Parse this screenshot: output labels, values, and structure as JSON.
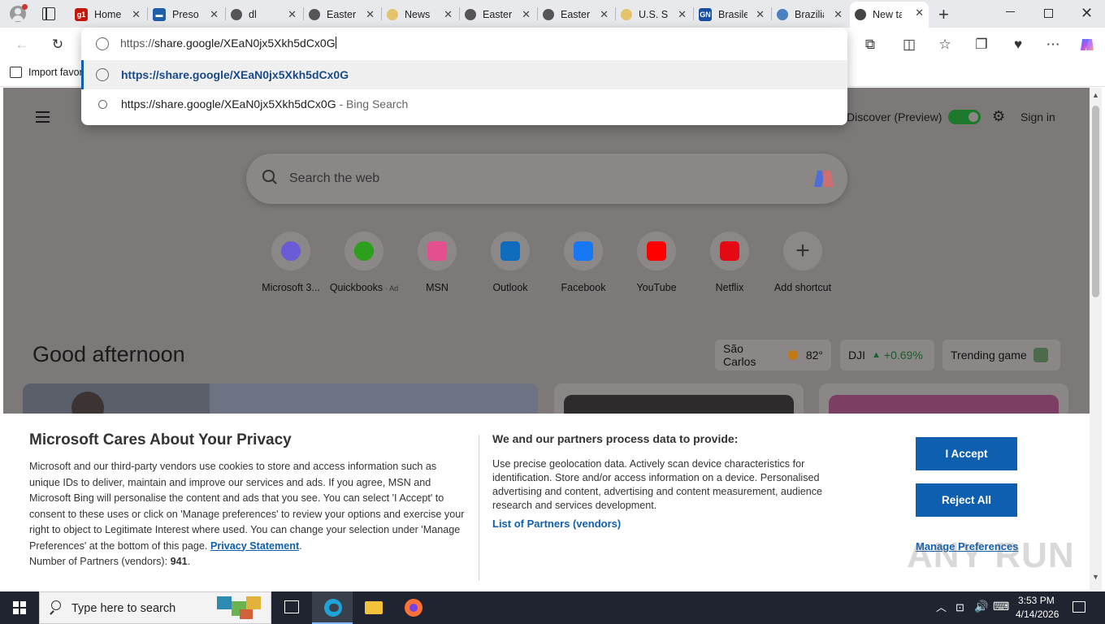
{
  "tabs": [
    {
      "title": "Home",
      "favicon_text": "g1",
      "favicon_color": "#c4170c"
    },
    {
      "title": "Preso",
      "favicon_text": "▬",
      "favicon_color": "#1f5fa8"
    },
    {
      "title": "dl",
      "favicon_text": "",
      "favicon_color": "#555555"
    },
    {
      "title": "Eastern",
      "favicon_text": "",
      "favicon_color": "#555555"
    },
    {
      "title": "News",
      "favicon_text": "",
      "favicon_color": "#e3c46b"
    },
    {
      "title": "Eastern",
      "favicon_text": "",
      "favicon_color": "#555555"
    },
    {
      "title": "Eastern",
      "favicon_text": "",
      "favicon_color": "#555555"
    },
    {
      "title": "U.S. Se",
      "favicon_text": "",
      "favicon_color": "#e3c46b"
    },
    {
      "title": "Brasile",
      "favicon_text": "GN",
      "favicon_color": "#1a4fa0"
    },
    {
      "title": "Brazilia",
      "favicon_text": "",
      "favicon_color": "#4a7fc0"
    },
    {
      "title": "New ta",
      "favicon_text": "",
      "favicon_color": "#444444",
      "active": true
    }
  ],
  "omnibox": {
    "prefix": "https://",
    "host": "share.google/XEaN0jx5Xkh5dCx0G",
    "suggestions": [
      {
        "text": "https://share.google/XEaN0jx5Xkh5dCx0G",
        "suffix": ""
      },
      {
        "text": "https://share.google/XEaN0jx5Xkh5dCx0G",
        "suffix": " - Bing Search"
      }
    ]
  },
  "favbar": {
    "import_label": "Import favor"
  },
  "ntp": {
    "discover_label": "Discover (Preview)",
    "signin_label": "Sign in",
    "search_placeholder": "Search the web",
    "greeting": "Good afternoon",
    "shortcuts": [
      {
        "label": "Microsoft 3...",
        "icon": "m365-icon",
        "color": "#6a5bd6"
      },
      {
        "label": "Quickbooks",
        "ad": "· Ad",
        "icon": "quickbooks-icon",
        "color": "#2ca01c"
      },
      {
        "label": "MSN",
        "icon": "msn-icon",
        "color": "#e34f8f"
      },
      {
        "label": "Outlook",
        "icon": "outlook-icon",
        "color": "#0f6cbd"
      },
      {
        "label": "Facebook",
        "icon": "facebook-icon",
        "color": "#1877f2"
      },
      {
        "label": "YouTube",
        "icon": "youtube-icon",
        "color": "#ff0000"
      },
      {
        "label": "Netflix",
        "icon": "netflix-icon",
        "color": "#e50914"
      },
      {
        "label": "Add shortcut",
        "icon": "plus-icon",
        "color": "#333333"
      }
    ],
    "weather": {
      "city": "São Carlos",
      "temp": "82°"
    },
    "stock": {
      "symbol": "DJI",
      "change": "+0.69%"
    },
    "trending": "Trending game"
  },
  "privacy": {
    "title": "Microsoft Cares About Your Privacy",
    "body": "Microsoft and our third-party vendors use cookies to store and access information such as unique IDs to deliver, maintain and improve our services and ads. If you agree, MSN and Microsoft Bing will personalise the content and ads that you see. You can select 'I Accept' to consent to these uses or click on 'Manage preferences' to review your options and exercise your right to object to Legitimate Interest where used.  You can change your selection under 'Manage Preferences' at the bottom of this page.",
    "privacy_link": "Privacy Statement",
    "partners_label": "Number of Partners (vendors):",
    "partners_count": "941",
    "process_title": "We and our partners process data to provide:",
    "process_body": "Use precise geolocation data. Actively scan device characteristics for identification. Store and/or access information on a device. Personalised advertising and content, advertising and content measurement, audience research and services development.",
    "list_partners": "List of Partners (vendors)",
    "accept": "I Accept",
    "reject": "Reject All",
    "manage": "Manage Preferences"
  },
  "taskbar": {
    "search_placeholder": "Type here to search",
    "time": "3:53 PM",
    "date": "4/14/2026"
  },
  "watermark": "ANY RUN"
}
